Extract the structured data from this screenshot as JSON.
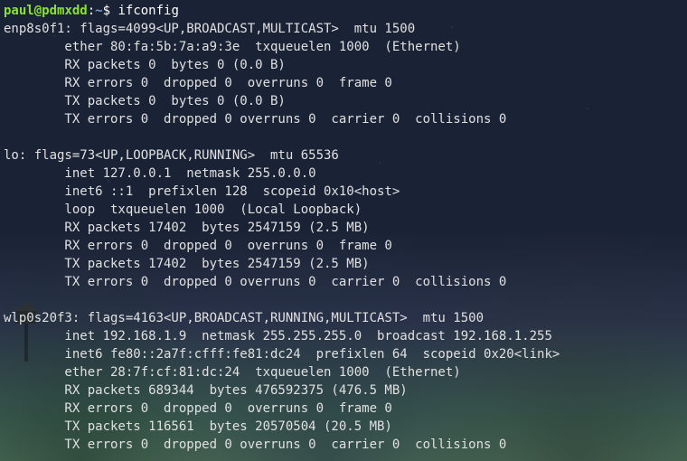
{
  "prompt": {
    "user": "paul",
    "at": "@",
    "host": "pdmxdd",
    "colon": ":",
    "path": "~",
    "dollar": "$ "
  },
  "command": "ifconfig",
  "interfaces": [
    {
      "name": "enp8s0f1",
      "header": "enp8s0f1: flags=4099<UP,BROADCAST,MULTICAST>  mtu 1500",
      "detail_lines": [
        "        ether 80:fa:5b:7a:a9:3e  txqueuelen 1000  (Ethernet)",
        "        RX packets 0  bytes 0 (0.0 B)",
        "        RX errors 0  dropped 0  overruns 0  frame 0",
        "        TX packets 0  bytes 0 (0.0 B)",
        "        TX errors 0  dropped 0 overruns 0  carrier 0  collisions 0"
      ]
    },
    {
      "name": "lo",
      "header": "lo: flags=73<UP,LOOPBACK,RUNNING>  mtu 65536",
      "detail_lines": [
        "        inet 127.0.0.1  netmask 255.0.0.0",
        "        inet6 ::1  prefixlen 128  scopeid 0x10<host>",
        "        loop  txqueuelen 1000  (Local Loopback)",
        "        RX packets 17402  bytes 2547159 (2.5 MB)",
        "        RX errors 0  dropped 0  overruns 0  frame 0",
        "        TX packets 17402  bytes 2547159 (2.5 MB)",
        "        TX errors 0  dropped 0 overruns 0  carrier 0  collisions 0"
      ]
    },
    {
      "name": "wlp0s20f3",
      "header": "wlp0s20f3: flags=4163<UP,BROADCAST,RUNNING,MULTICAST>  mtu 1500",
      "detail_lines": [
        "        inet 192.168.1.9  netmask 255.255.255.0  broadcast 192.168.1.255",
        "        inet6 fe80::2a7f:cfff:fe81:dc24  prefixlen 64  scopeid 0x20<link>",
        "        ether 28:7f:cf:81:dc:24  txqueuelen 1000  (Ethernet)",
        "        RX packets 689344  bytes 476592375 (476.5 MB)",
        "        RX errors 0  dropped 0  overruns 0  frame 0",
        "        TX packets 116561  bytes 20570504 (20.5 MB)",
        "        TX errors 0  dropped 0 overruns 0  carrier 0  collisions 0"
      ]
    }
  ]
}
